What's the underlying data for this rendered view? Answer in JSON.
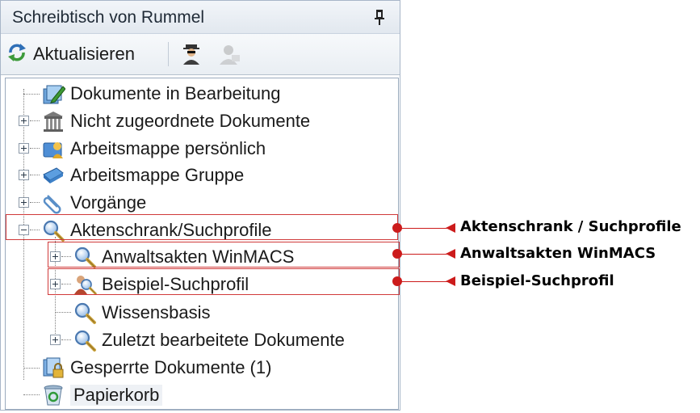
{
  "panel": {
    "title": "Schreibtisch von Rummel",
    "pin_icon": "pin-icon"
  },
  "toolbar": {
    "refresh_label": "Aktualisieren",
    "refresh_icon": "refresh-icon",
    "user_icon": "agent-user-icon",
    "user2_icon": "user-disabled-icon"
  },
  "tree": {
    "items": [
      {
        "label": "Dokumente in Bearbeitung",
        "icon": "edit-documents-icon",
        "expander": "none"
      },
      {
        "label": "Nicht zugeordnete Dokumente",
        "icon": "archive-building-icon",
        "expander": "plus"
      },
      {
        "label": "Arbeitsmappe persönlich",
        "icon": "personal-folder-icon",
        "expander": "plus"
      },
      {
        "label": "Arbeitsmappe Gruppe",
        "icon": "group-folder-icon",
        "expander": "plus"
      },
      {
        "label": "Vorgänge",
        "icon": "paperclip-icon",
        "expander": "plus"
      },
      {
        "label": "Aktenschrank/Suchprofile",
        "icon": "search-icon",
        "expander": "minus"
      },
      {
        "label": "Anwaltsakten WinMACS",
        "icon": "search-icon",
        "expander": "plus"
      },
      {
        "label": "Beispiel-Suchprofil",
        "icon": "user-search-icon",
        "expander": "plus"
      },
      {
        "label": "Wissensbasis",
        "icon": "search-icon",
        "expander": "none"
      },
      {
        "label": "Zuletzt bearbeitete Dokumente",
        "icon": "search-icon",
        "expander": "plus"
      },
      {
        "label": "Gesperrte Dokumente (1)",
        "icon": "locked-documents-icon",
        "expander": "none"
      },
      {
        "label": "Papierkorb",
        "icon": "recycle-bin-icon",
        "expander": "none"
      }
    ]
  },
  "callouts": [
    {
      "label": "Aktenschrank / Suchprofile"
    },
    {
      "label": "Anwaltsakten WinMACS"
    },
    {
      "label": "Beispiel-Suchprofil"
    }
  ],
  "colors": {
    "highlight": "#cc1b1b",
    "accent_blue": "#2f6fb7"
  }
}
